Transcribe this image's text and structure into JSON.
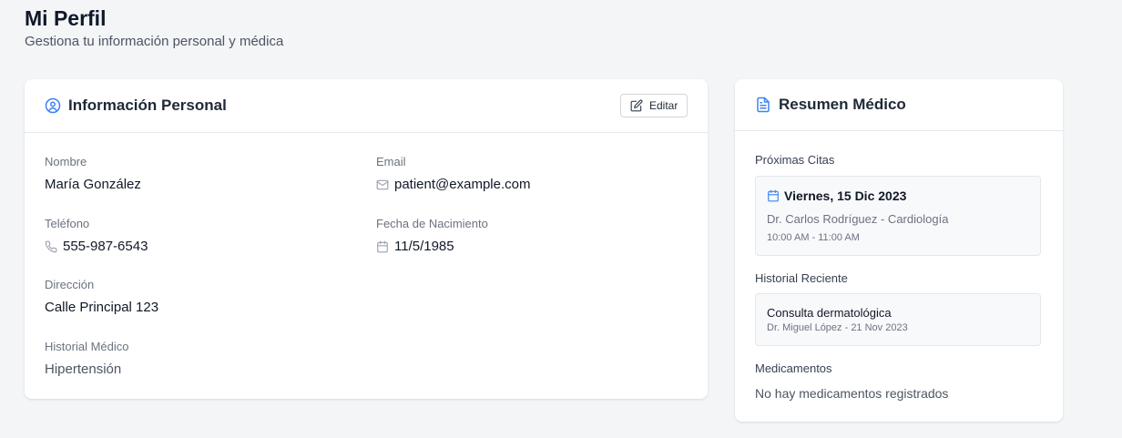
{
  "page": {
    "title": "Mi Perfil",
    "subtitle": "Gestiona tu información personal y médica"
  },
  "personal_card": {
    "title": "Información Personal",
    "title_icon": "user-circle-icon",
    "edit_label": "Editar",
    "edit_icon": "edit-icon",
    "fields": {
      "name": {
        "label": "Nombre",
        "value": "María González"
      },
      "email": {
        "label": "Email",
        "value": "patient@example.com",
        "icon": "mail-icon"
      },
      "phone": {
        "label": "Teléfono",
        "value": "555-987-6543",
        "icon": "phone-icon"
      },
      "birthdate": {
        "label": "Fecha de Nacimiento",
        "value": "11/5/1985",
        "icon": "calendar-icon"
      },
      "address": {
        "label": "Dirección",
        "value": "Calle Principal 123"
      },
      "medical_history": {
        "label": "Historial Médico",
        "value": "Hipertensión"
      }
    }
  },
  "medical_card": {
    "title": "Resumen Médico",
    "title_icon": "document-icon",
    "upcoming": {
      "label": "Próximas Citas",
      "date": "Viernes, 15 Dic 2023",
      "date_icon": "calendar-icon",
      "doctor": "Dr. Carlos Rodríguez - Cardiología",
      "time": "10:00 AM - 11:00 AM"
    },
    "history": {
      "label": "Historial Reciente",
      "title": "Consulta dermatológica",
      "meta": "Dr. Miguel López - 21 Nov 2023"
    },
    "medications": {
      "label": "Medicamentos",
      "empty": "No hay medicamentos registrados"
    }
  },
  "colors": {
    "accent": "#3b82f6",
    "background": "#f4f5f7",
    "card": "#ffffff"
  }
}
